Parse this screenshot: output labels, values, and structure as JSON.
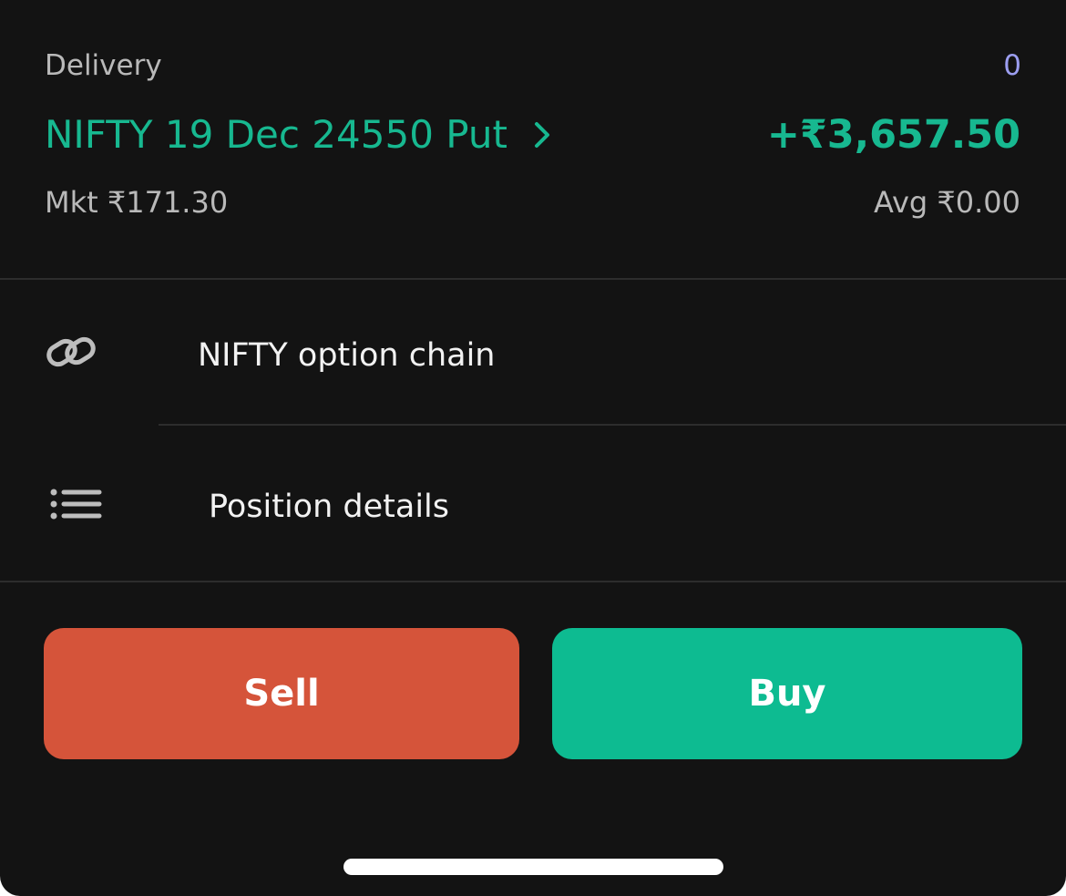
{
  "position": {
    "order_type": "Delivery",
    "quantity": "0",
    "instrument": "NIFTY 19 Dec 24550 Put",
    "pnl": "+₹3,657.50",
    "market_price": "Mkt ₹171.30",
    "average_price": "Avg ₹0.00"
  },
  "menu": [
    {
      "label": "NIFTY option chain",
      "icon": "link-icon"
    },
    {
      "label": "Position details",
      "icon": "list-icon"
    }
  ],
  "actions": {
    "sell_label": "Sell",
    "buy_label": "Buy"
  },
  "colors": {
    "background": "#131313",
    "profit_green": "#17b890",
    "sell": "#d5543a",
    "buy": "#0dbb91",
    "quantity": "#9c9ef0"
  }
}
